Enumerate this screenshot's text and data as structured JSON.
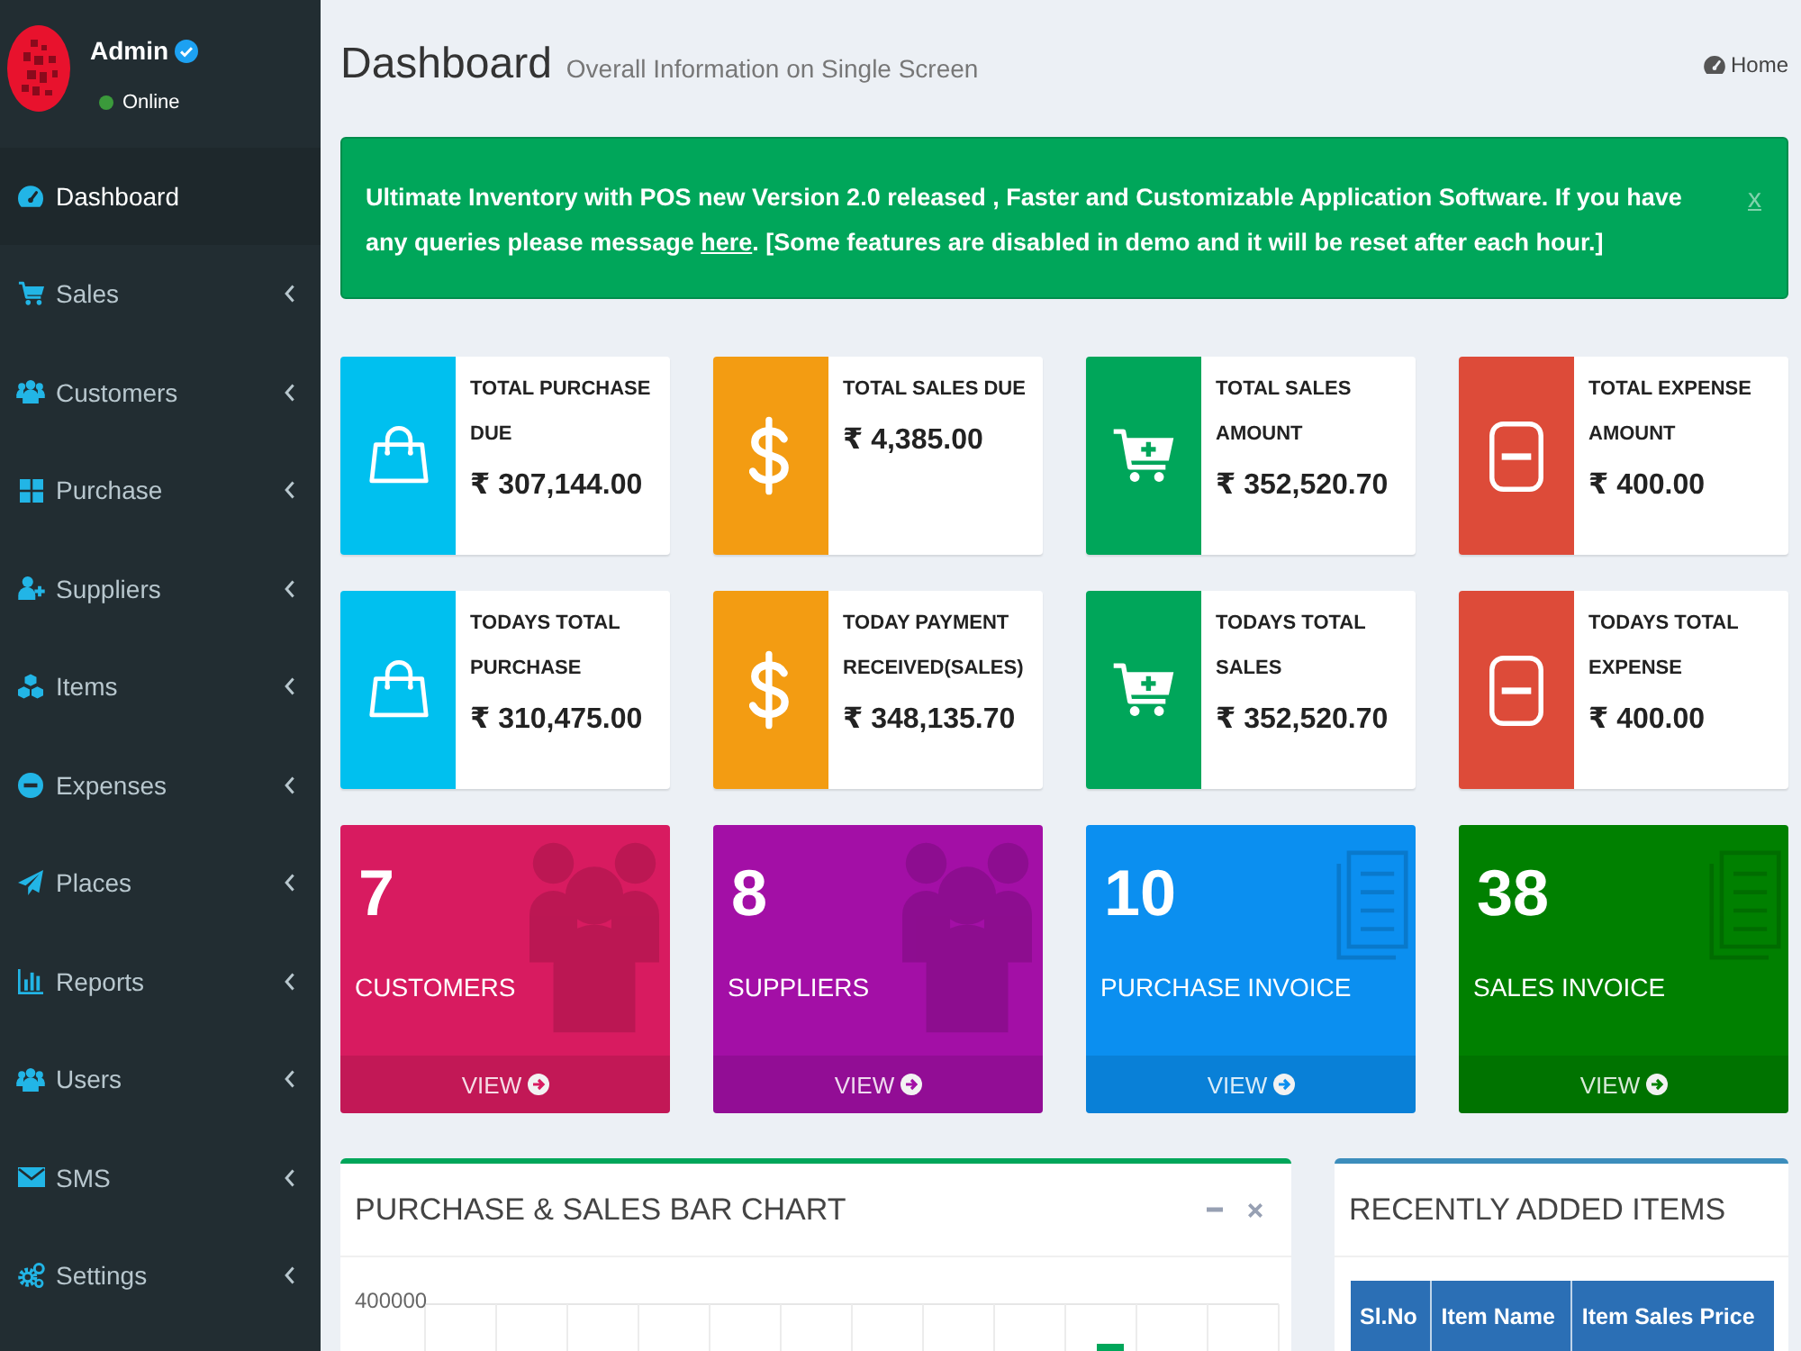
{
  "sidebar": {
    "user": {
      "name": "Admin",
      "verified": true,
      "status": "Online",
      "online": true
    },
    "items": [
      {
        "label": "Dashboard",
        "kind": "link",
        "selected": true
      },
      {
        "label": "Sales",
        "kind": "submenu",
        "selected": false
      },
      {
        "label": "Customers",
        "kind": "submenu",
        "selected": false
      },
      {
        "label": "Purchase",
        "kind": "submenu",
        "selected": false
      },
      {
        "label": "Suppliers",
        "kind": "submenu",
        "selected": false
      },
      {
        "label": "Items",
        "kind": "submenu",
        "selected": false
      },
      {
        "label": "Expenses",
        "kind": "submenu",
        "selected": false
      },
      {
        "label": "Places",
        "kind": "submenu",
        "selected": false
      },
      {
        "label": "Reports",
        "kind": "submenu",
        "selected": false
      },
      {
        "label": "Users",
        "kind": "submenu",
        "selected": false
      },
      {
        "label": "SMS",
        "kind": "submenu",
        "selected": false
      },
      {
        "label": "Settings",
        "kind": "submenu",
        "selected": false
      }
    ]
  },
  "header": {
    "title": "Dashboard",
    "subtitle": "Overall Information on Single Screen",
    "breadcrumb": "Home"
  },
  "alert": {
    "text_before": "Ultimate Inventory with POS new Version 2.0 released , Faster and Customizable Application Software. If you have any queries please message ",
    "link": "here",
    "text_after": ". [Some features are disabled in demo and it will be reset after each hour.]",
    "close": "x"
  },
  "info_boxes": [
    {
      "color": "#00c0ef",
      "label": "TOTAL PURCHASE DUE",
      "value": "₹ 307,144.00"
    },
    {
      "color": "#f39c12",
      "label": "TOTAL SALES DUE",
      "value": "₹ 4,385.00"
    },
    {
      "color": "#00a65a",
      "label": "TOTAL SALES AMOUNT",
      "value": "₹ 352,520.70"
    },
    {
      "color": "#dd4b39",
      "label": "TOTAL EXPENSE AMOUNT",
      "value": "₹ 400.00"
    },
    {
      "color": "#00c0ef",
      "label": "TODAYS TOTAL PURCHASE",
      "value": "₹ 310,475.00"
    },
    {
      "color": "#f39c12",
      "label": "TODAY PAYMENT RECEIVED(SALES)",
      "value": "₹ 348,135.70"
    },
    {
      "color": "#00a65a",
      "label": "TODAYS TOTAL SALES",
      "value": "₹ 352,520.70"
    },
    {
      "color": "#dd4b39",
      "label": "TODAYS TOTAL EXPENSE",
      "value": "₹ 400.00"
    }
  ],
  "stat_tiles": [
    {
      "count": "7",
      "label": "CUSTOMERS",
      "link": "VIEW",
      "color": "#d81b60"
    },
    {
      "count": "8",
      "label": "SUPPLIERS",
      "link": "VIEW",
      "color": "#a30fa6"
    },
    {
      "count": "10",
      "label": "PURCHASE INVOICE",
      "link": "VIEW",
      "color": "#0b8ff0"
    },
    {
      "count": "38",
      "label": "SALES INVOICE",
      "link": "VIEW",
      "color": "#008000"
    }
  ],
  "chart_panel": {
    "title": "PURCHASE & SALES BAR CHART",
    "y_tick": "400000"
  },
  "recent_items": {
    "title": "RECENTLY ADDED ITEMS",
    "columns": [
      "Sl.No",
      "Item Name",
      "Item Sales Price"
    ]
  }
}
